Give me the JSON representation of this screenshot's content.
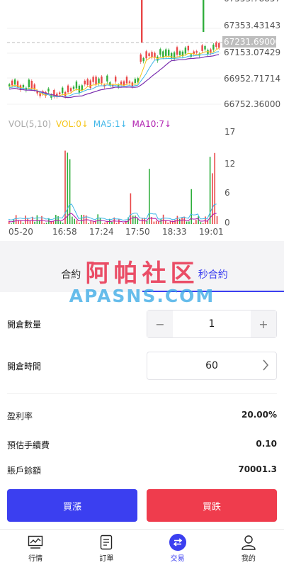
{
  "chart": {
    "price_ticks": [
      "67353.43143",
      "67153.07429",
      "66952.71714",
      "66752.36000"
    ],
    "current_price": "67231.69000",
    "volume_legend": {
      "base": "VOL(5,10)",
      "vol": "VOL:0↓",
      "ma5": "MA5:1↓",
      "ma10": "MA10:7↓"
    },
    "volume_ticks": [
      "17",
      "12",
      "6",
      "0"
    ],
    "time_labels": [
      "05-20",
      "16:58",
      "17:24",
      "17:50",
      "18:33",
      "19:01"
    ],
    "colors": {
      "up": "#2fae3c",
      "down": "#e94748",
      "ma5": "#f5c518",
      "ma10": "#3fb6e8",
      "ma30": "#7b2fb0",
      "vol_ma5": "#3fb6e8",
      "vol_ma10": "#b020b0",
      "vol_label": "#f5c518"
    }
  },
  "tabs": [
    {
      "label": "合約"
    },
    {
      "label": "秒合約"
    }
  ],
  "form": {
    "quantity_label": "開倉數量",
    "quantity_value": "1",
    "minus": "−",
    "plus": "+",
    "time_label": "開倉時間",
    "time_value": "60"
  },
  "info": {
    "profit_rate_label": "盈利率",
    "profit_rate_value": "20.00%",
    "fee_label": "預估手續費",
    "fee_value": "0.10",
    "balance_label": "賬戶餘額",
    "balance_value": "70001.3"
  },
  "actions": {
    "buy_up": "買漲",
    "buy_down": "買跌",
    "buy_up_color": "#3b3ff0",
    "buy_down_color": "#ef3c4d"
  },
  "nav": [
    {
      "label": "行情",
      "icon": "chart-icon"
    },
    {
      "label": "訂單",
      "icon": "document-icon"
    },
    {
      "label": "交易",
      "icon": "swap-icon"
    },
    {
      "label": "我的",
      "icon": "user-icon"
    }
  ],
  "watermark": {
    "cn": "阿帕社区",
    "en": "APASNS.COM"
  }
}
